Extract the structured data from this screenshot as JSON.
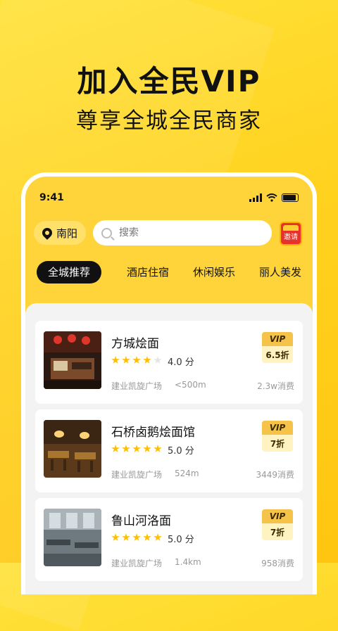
{
  "hero": {
    "title": "加入全民VIP",
    "subtitle": "尊享全城全民商家"
  },
  "status_bar": {
    "time": "9:41"
  },
  "location": {
    "city": "南阳"
  },
  "search": {
    "placeholder": "搜索"
  },
  "invite": {
    "label": "邀请"
  },
  "tabs": [
    {
      "label": "全城推荐",
      "active": true
    },
    {
      "label": "酒店住宿",
      "active": false
    },
    {
      "label": "休闲娱乐",
      "active": false
    },
    {
      "label": "丽人美发",
      "active": false
    }
  ],
  "merchants": [
    {
      "name": "方城烩面",
      "rating": 4.0,
      "rating_text": "4.0 分",
      "address": "建业凯旋广场",
      "distance": "<500m",
      "spend": "2.3w消费",
      "vip_label": "VIP",
      "discount": "6.5折"
    },
    {
      "name": "石桥卤鹅烩面馆",
      "rating": 5.0,
      "rating_text": "5.0 分",
      "address": "建业凯旋广场",
      "distance": "524m",
      "spend": "3449消费",
      "vip_label": "VIP",
      "discount": "7折"
    },
    {
      "name": "鲁山河洛面",
      "rating": 5.0,
      "rating_text": "5.0 分",
      "address": "建业凯旋广场",
      "distance": "1.4km",
      "spend": "958消费",
      "vip_label": "VIP",
      "discount": "7折"
    }
  ]
}
